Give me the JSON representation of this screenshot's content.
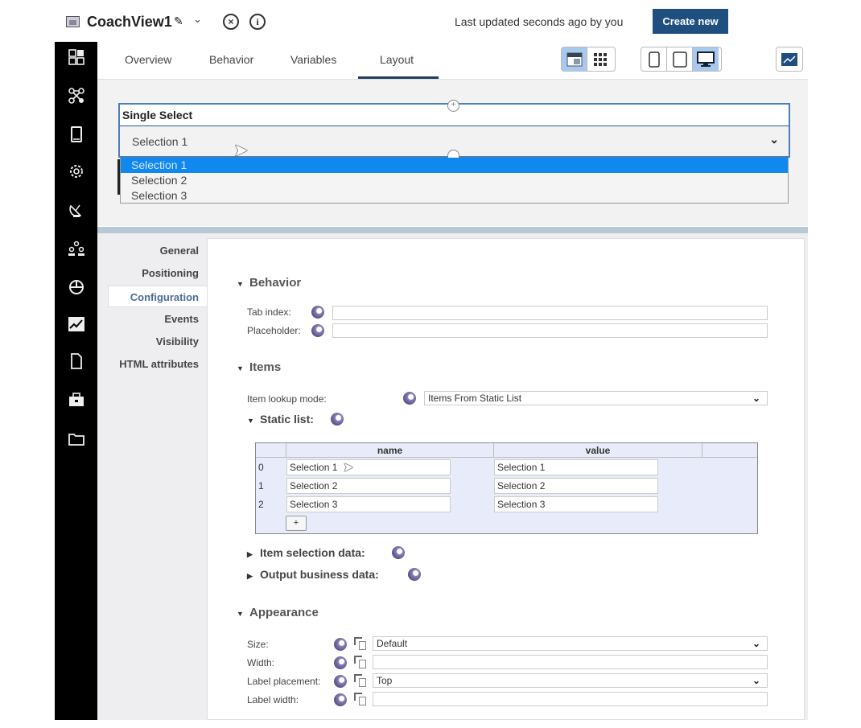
{
  "header": {
    "title": "CoachView1",
    "last_updated": "Last updated seconds ago by you",
    "create_new": "Create new",
    "icons": {
      "doc": "coach-view-icon",
      "edit": "pencil-icon",
      "menu": "chevron-down-icon",
      "close": "close-circle-icon",
      "info": "info-icon"
    }
  },
  "rail": {
    "items": [
      {
        "icon": "layout-grid-icon",
        "glyph": "⊞"
      },
      {
        "icon": "flow-icon",
        "glyph": "⫘"
      },
      {
        "icon": "tablet-icon",
        "glyph": "▯"
      },
      {
        "icon": "gear-icon",
        "glyph": "⚙"
      },
      {
        "icon": "satellite-dish-icon",
        "glyph": "📡"
      },
      {
        "icon": "team-icon",
        "glyph": "⚇"
      },
      {
        "icon": "pie-chart-icon",
        "glyph": "◔"
      },
      {
        "icon": "trend-chart-icon",
        "glyph": "📈"
      },
      {
        "icon": "file-icon",
        "glyph": "🗋"
      },
      {
        "icon": "toolbox-icon",
        "glyph": "🧰"
      },
      {
        "icon": "folder-icon",
        "glyph": "🗀"
      }
    ]
  },
  "tabs": [
    {
      "label": "Overview",
      "active": false
    },
    {
      "label": "Behavior",
      "active": false
    },
    {
      "label": "Variables",
      "active": false
    },
    {
      "label": "Layout",
      "active": true
    }
  ],
  "toolbar": {
    "view_modes": [
      "design-view-icon",
      "grid-view-icon"
    ],
    "active_view": "design-view-icon",
    "devices": [
      "phone-icon",
      "tablet-icon",
      "desktop-icon"
    ],
    "active_device": "desktop-icon",
    "preview": "preview-chart-icon"
  },
  "canvas": {
    "control_label": "Single Select",
    "selected_value": "Selection 1",
    "dropdown_options": [
      "Selection 1",
      "Selection 2",
      "Selection 3"
    ],
    "highlighted_option": "Selection 1"
  },
  "properties": {
    "side_tabs": [
      "General",
      "Positioning",
      "Configuration",
      "Events",
      "Visibility",
      "HTML attributes"
    ],
    "active_side_tab": "Configuration",
    "behavior": {
      "title": "Behavior",
      "tab_index_label": "Tab index:",
      "tab_index_value": "",
      "placeholder_label": "Placeholder:",
      "placeholder_value": ""
    },
    "items": {
      "title": "Items",
      "lookup_label": "Item lookup mode:",
      "lookup_value": "Items From Static List",
      "static_list_label": "Static list:",
      "static_list": {
        "columns": [
          "name",
          "value"
        ],
        "rows": [
          {
            "index": "0",
            "name": "Selection 1",
            "value": "Selection 1"
          },
          {
            "index": "1",
            "name": "Selection 2",
            "value": "Selection 2"
          },
          {
            "index": "2",
            "name": "Selection 3",
            "value": "Selection 3"
          }
        ],
        "add_label": "+"
      },
      "item_selection_label": "Item selection data:",
      "output_business_label": "Output business data:"
    },
    "appearance": {
      "title": "Appearance",
      "size_label": "Size:",
      "size_value": "Default",
      "width_label": "Width:",
      "width_value": "",
      "label_placement_label": "Label placement:",
      "label_placement_value": "Top",
      "label_width_label": "Label width:",
      "label_width_value": ""
    }
  },
  "colors": {
    "primary": "#1f4f7f",
    "highlight": "#1188ee",
    "rail": "#000000",
    "active_toggle": "#a8c8ee"
  }
}
